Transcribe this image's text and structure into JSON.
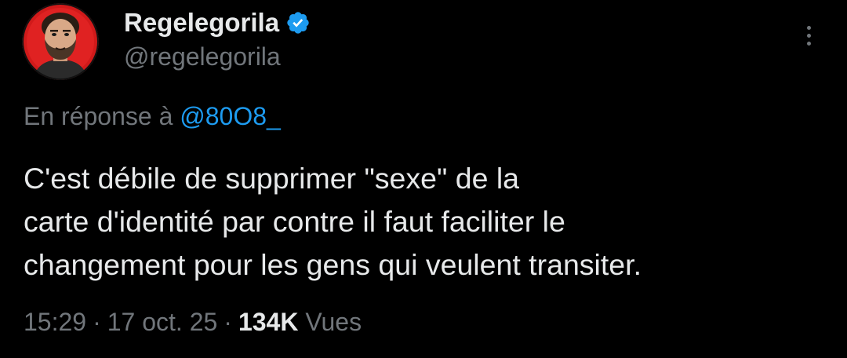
{
  "colors": {
    "background": "#000000",
    "primary_text": "#e7e9ea",
    "secondary_text": "#71767b",
    "link": "#1d9bf0",
    "verified_badge": "#1d9bf0",
    "avatar_ring": "#d11a1a"
  },
  "author": {
    "display_name": "Regelegorila",
    "handle": "@regelegorila",
    "verified": true,
    "avatar_icon": "cartoon-bearded-man-avatar"
  },
  "menu": {
    "icon": "more-vertical-icon"
  },
  "reply": {
    "prefix": "En réponse à",
    "target": "@80O8_"
  },
  "tweet": {
    "lines": [
      "C'est débile de supprimer \"sexe\" de la",
      "carte d'identité par contre il faut faciliter le",
      "changement pour les gens qui veulent transiter."
    ]
  },
  "meta": {
    "time": "15:29",
    "date": "17 oct. 25",
    "views_count": "134K",
    "views_label": "Vues",
    "separator": "·"
  }
}
